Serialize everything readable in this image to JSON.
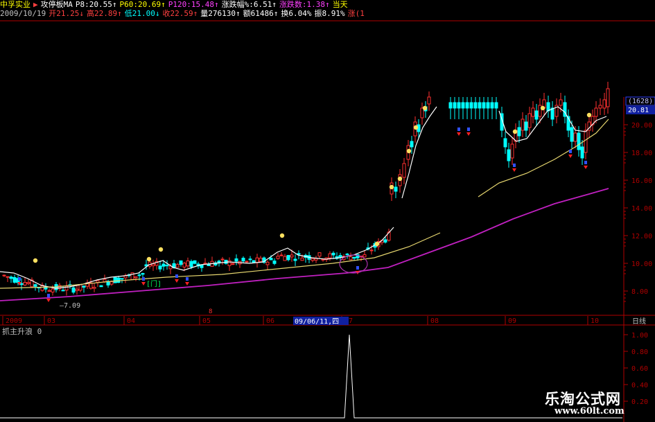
{
  "header": {
    "row1": [
      {
        "text": "中孚实业",
        "color": "#ffff00"
      },
      {
        "text": "▶",
        "color": "#ff4040"
      },
      {
        "text": "攻停板MA",
        "color": "#ffffff"
      },
      {
        "text": "P8:20.55↑",
        "color": "#ffffff"
      },
      {
        "text": "P60:20.69↑",
        "color": "#ffff00"
      },
      {
        "text": "P120:15.48↑",
        "color": "#ff40ff"
      },
      {
        "text": "涨跌幅%:6.51↑",
        "color": "#ffffff"
      },
      {
        "text": "涨跌数:1.38↑",
        "color": "#ff40ff"
      },
      {
        "text": "当天",
        "color": "#ffff00"
      }
    ],
    "row2": [
      {
        "text": "2009/10/19",
        "color": "#c0c0c0"
      },
      {
        "text": "开21.25↓",
        "color": "#ff4040"
      },
      {
        "text": "高22.89↑",
        "color": "#ff4040"
      },
      {
        "text": "低21.00↓",
        "color": "#00ffff"
      },
      {
        "text": "收22.59↑",
        "color": "#ff4040"
      },
      {
        "text": "量276130↑",
        "color": "#ffffff"
      },
      {
        "text": "额61486↑",
        "color": "#ffffff"
      },
      {
        "text": "换6.04%",
        "color": "#ffffff"
      },
      {
        "text": "振8.91%",
        "color": "#ffffff"
      },
      {
        "text": "涨(1",
        "color": "#ff4040"
      }
    ]
  },
  "price_axis": {
    "labels": [
      "20.00",
      "18.00",
      "16.00",
      "14.00",
      "12.00",
      "10.00",
      "8.00"
    ],
    "values": [
      20,
      18,
      16,
      14,
      12,
      10,
      8
    ],
    "volume_badge": "(1628)",
    "current_price": "20.81",
    "low_label": "7.09"
  },
  "date_axis": {
    "labels": [
      "2009",
      "03",
      "04",
      "05",
      "06",
      "07",
      "08",
      "09",
      "10"
    ],
    "cursor_date": "09/06/11,四",
    "period": "日线"
  },
  "indicator": {
    "name": "抓主升浪",
    "value": "0",
    "ticks": [
      "1.00",
      "0.80",
      "0.60",
      "0.40",
      "0.20"
    ]
  },
  "annotations": {
    "signal_box": "[门]"
  },
  "watermark": {
    "title": "乐淘公式网",
    "url": "www.60lt.com"
  },
  "colors": {
    "up": "#ff3030",
    "down": "#00ffff",
    "ma_short": "#ffffff",
    "ma_mid": "#e8d870",
    "ma_long": "#c020c0",
    "grid_red": "#b00000"
  },
  "chart_data": {
    "type": "candlestick",
    "series_ma_short_approx": [
      [
        0,
        9.4
      ],
      [
        20,
        9.3
      ],
      [
        40,
        8.9
      ],
      [
        60,
        8.4
      ],
      [
        80,
        8.2
      ],
      [
        100,
        8.3
      ],
      [
        120,
        8.5
      ],
      [
        140,
        8.8
      ],
      [
        160,
        9.0
      ],
      [
        180,
        9.1
      ],
      [
        200,
        9.3
      ],
      [
        215,
        9.9
      ],
      [
        235,
        10.2
      ],
      [
        250,
        9.7
      ],
      [
        265,
        9.5
      ],
      [
        290,
        9.9
      ],
      [
        310,
        10.0
      ],
      [
        330,
        10.1
      ],
      [
        360,
        10.0
      ],
      [
        380,
        10.1
      ],
      [
        400,
        10.8
      ],
      [
        415,
        11.1
      ],
      [
        430,
        10.6
      ],
      [
        450,
        10.4
      ],
      [
        470,
        10.3
      ],
      [
        490,
        10.4
      ],
      [
        510,
        10.6
      ],
      [
        530,
        11.0
      ],
      [
        550,
        11.6
      ],
      [
        568,
        12.6
      ]
    ],
    "series_ma_short_late": [
      [
        580,
        14.7
      ],
      [
        590,
        16.5
      ],
      [
        600,
        18.5
      ],
      [
        610,
        19.8
      ],
      [
        620,
        20.6
      ],
      [
        630,
        21.3
      ]
    ],
    "series_ma_short_after": [
      [
        720,
        21.0
      ],
      [
        730,
        19.5
      ],
      [
        745,
        18.8
      ],
      [
        760,
        19.0
      ],
      [
        775,
        20.0
      ],
      [
        790,
        21.0
      ],
      [
        805,
        21.3
      ],
      [
        815,
        20.9
      ],
      [
        830,
        19.6
      ],
      [
        845,
        19.5
      ],
      [
        860,
        20.3
      ],
      [
        875,
        20.6
      ]
    ],
    "series_ma_mid": [
      [
        0,
        8.2
      ],
      [
        80,
        8.3
      ],
      [
        160,
        8.7
      ],
      [
        240,
        9.0
      ],
      [
        320,
        9.2
      ],
      [
        400,
        9.6
      ],
      [
        480,
        10.0
      ],
      [
        540,
        10.4
      ],
      [
        590,
        11.2
      ],
      [
        635,
        12.2
      ]
    ],
    "series_ma_mid_after": [
      [
        690,
        14.8
      ],
      [
        720,
        15.8
      ],
      [
        760,
        16.5
      ],
      [
        800,
        17.5
      ],
      [
        830,
        18.4
      ],
      [
        860,
        19.4
      ],
      [
        878,
        20.4
      ]
    ],
    "series_ma_long": [
      [
        0,
        7.3
      ],
      [
        100,
        7.6
      ],
      [
        200,
        8.0
      ],
      [
        300,
        8.4
      ],
      [
        400,
        8.9
      ],
      [
        500,
        9.3
      ],
      [
        560,
        9.7
      ],
      [
        620,
        10.8
      ],
      [
        680,
        11.9
      ],
      [
        740,
        13.2
      ],
      [
        800,
        14.3
      ],
      [
        850,
        15.0
      ],
      [
        878,
        15.4
      ]
    ]
  }
}
